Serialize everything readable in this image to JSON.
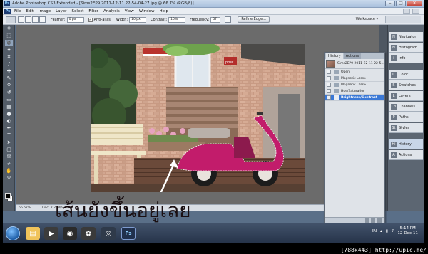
{
  "window": {
    "title": "Adobe Photoshop CS3 Extended - [Sims2EP9 2011-12-11 22-54-04-27.jpg @ 66.7% (RGB/8)]",
    "app_badge": "Ps",
    "min": "–",
    "max": "□",
    "close": "✕"
  },
  "menu": [
    "File",
    "Edit",
    "Image",
    "Layer",
    "Select",
    "Filter",
    "Analysis",
    "View",
    "Window",
    "Help"
  ],
  "options": {
    "feather_label": "Feather:",
    "feather_value": "0 px",
    "antialias_label": "Anti-alias",
    "width_label": "Width:",
    "width_value": "10 px",
    "contrast_label": "Contrast:",
    "contrast_value": "10%",
    "frequency_label": "Frequency:",
    "frequency_value": "57",
    "refine_edge": "Refine Edge...",
    "workspace": "Workspace ▾"
  },
  "status": {
    "zoom": "66.67%",
    "doc": "Doc: 2.25M/9.23M"
  },
  "dock": {
    "items": [
      {
        "icon": "N",
        "label": "Navigator"
      },
      {
        "icon": "H",
        "label": "Histogram"
      },
      {
        "icon": "i",
        "label": "Info"
      },
      {
        "icon": "C",
        "label": "Color"
      },
      {
        "icon": "S",
        "label": "Swatches"
      },
      {
        "icon": "L",
        "label": "Layers"
      },
      {
        "icon": "Ch",
        "label": "Channels"
      },
      {
        "icon": "P",
        "label": "Paths"
      },
      {
        "icon": "St",
        "label": "Styles"
      },
      {
        "icon": "Hi",
        "label": "History"
      },
      {
        "icon": "A",
        "label": "Actions"
      }
    ]
  },
  "history": {
    "tabs": [
      "History",
      "Actions"
    ],
    "snapshot": "Sims2EP9 2011-12-11 22-5...",
    "steps": [
      "Open",
      "Magnetic Lasso",
      "Magnetic Lasso",
      "Hue/Saturation",
      "Brightness/Contrast"
    ],
    "selected_index": 4
  },
  "overlay_text": "เส้นยังขึ้นอยู่เลย",
  "canvas": {
    "sign_text": "ppsr"
  },
  "taskbar": {
    "ps_label": "Ps",
    "lang": "EN",
    "time": "5:14 PM",
    "date": "12-Dec-11"
  },
  "watermark": "[788x443] http://upic.me/"
}
